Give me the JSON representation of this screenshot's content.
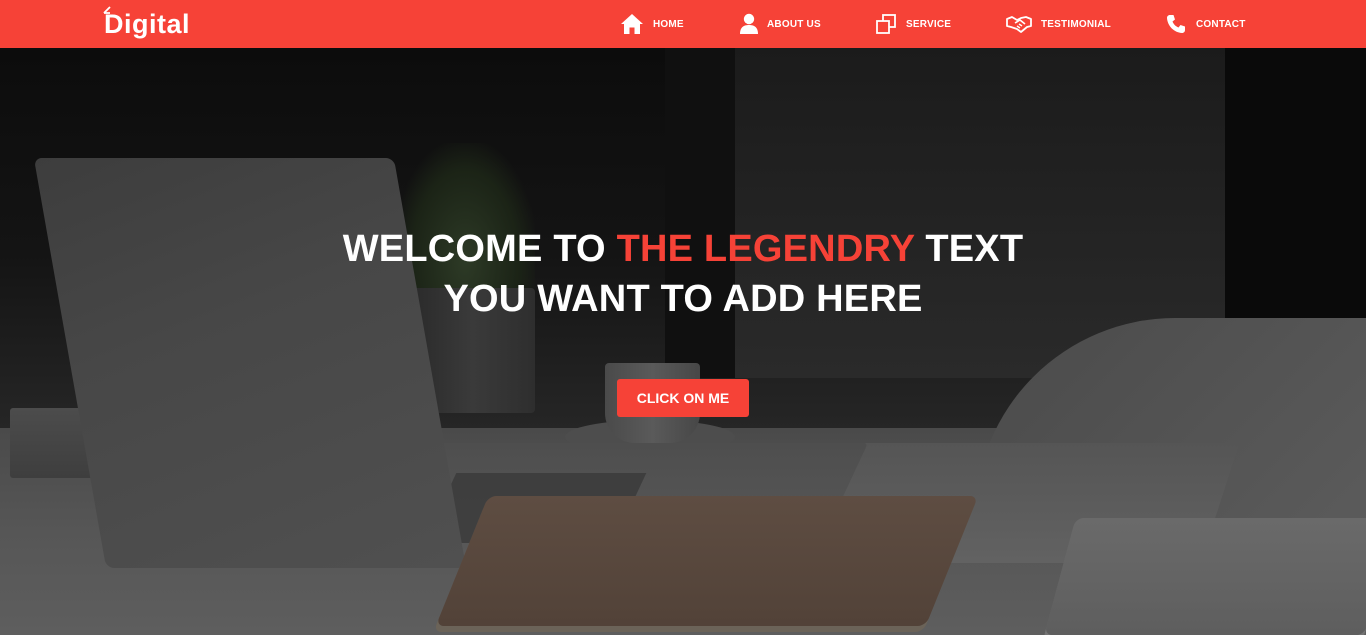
{
  "brand": {
    "logo_text": "Digital",
    "icon": "arrow-icon"
  },
  "nav": {
    "items": [
      {
        "label": "HOME",
        "icon": "home-icon"
      },
      {
        "label": "ABOUT US",
        "icon": "user-icon"
      },
      {
        "label": "SERVICE",
        "icon": "copy-icon"
      },
      {
        "label": "TESTIMONIAL",
        "icon": "handshake-icon"
      },
      {
        "label": "CONTACT",
        "icon": "phone-icon"
      }
    ]
  },
  "hero": {
    "title_line1_part1": "WELCOME TO ",
    "title_line1_highlight": "THE LEGENDRY",
    "title_line1_part2": " TEXT",
    "title_line2": "YOU WANT TO ADD HERE",
    "cta_label": "CLICK ON ME"
  },
  "colors": {
    "accent": "#f64237",
    "text_light": "#ffffff"
  }
}
